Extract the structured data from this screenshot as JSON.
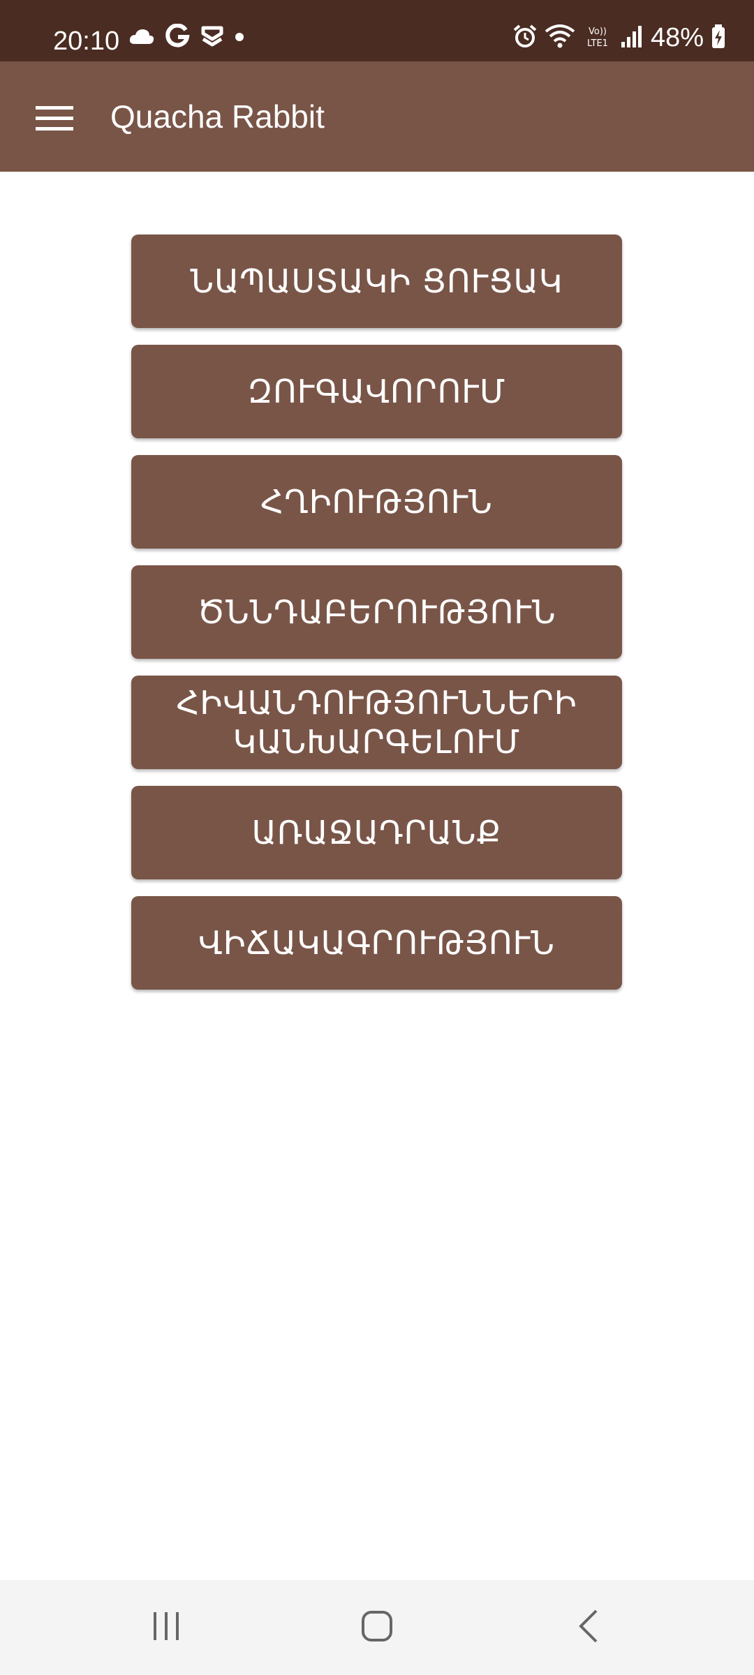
{
  "status_bar": {
    "time": "20:10",
    "battery": "48%",
    "icons": [
      "cloud-icon",
      "google-icon",
      "notification-app-icon",
      "dot-icon",
      "alarm-icon",
      "wifi-icon",
      "volte-icon",
      "signal-icon",
      "battery-charging-icon"
    ]
  },
  "app_bar": {
    "title": "Quacha Rabbit",
    "menu_icon": "menu-icon"
  },
  "menu": {
    "items": [
      {
        "label": "ՆԱՊԱՍՏԱԿԻ ՑՈՒՑԱԿ"
      },
      {
        "label": "ԶՈՒԳԱՎՈՐՈՒՄ"
      },
      {
        "label": "ՀՂԻՈՒԹՅՈՒՆ"
      },
      {
        "label": "ԾՆՆԴԱԲԵՐՈՒԹՅՈՒՆ"
      },
      {
        "label": "ՀԻՎԱՆԴՈՒԹՅՈՒՆՆԵՐԻ ԿԱՆԽԱՐԳԵԼՈՒՄ"
      },
      {
        "label": "ԱՌԱՋԱԴՐԱՆՔ"
      },
      {
        "label": "ՎԻՃԱԿԱԳՐՈՒԹՅՈՒՆ"
      }
    ]
  },
  "nav_bar": {
    "icons": [
      "recent-apps-icon",
      "home-icon",
      "back-icon"
    ]
  },
  "colors": {
    "status_bar": "#4a2c22",
    "primary": "#795548",
    "background": "#ffffff",
    "nav_bar": "#f4f4f4"
  }
}
